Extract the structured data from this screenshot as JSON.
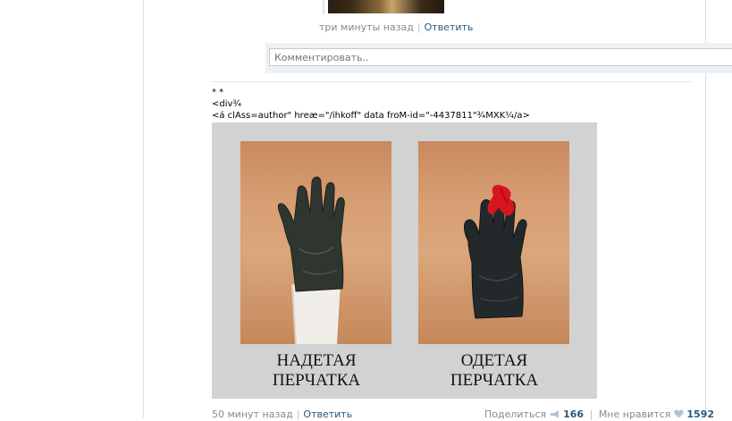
{
  "previous_post": {
    "time": "три минуты назад",
    "reply_label": "Ответить"
  },
  "comment": {
    "placeholder": "Комментировать.."
  },
  "post": {
    "code_line_1": "* *",
    "code_line_2": "<div¾",
    "code_line_3": "<á clAss=author\" hreæ=\"/ihkoff\" data froM-id=\"-4437811\"¾MXK¼/a>",
    "image": {
      "caption_left_1": "НАДЕТАЯ",
      "caption_left_2": "ПЕРЧАТКА",
      "caption_right_1": "ОДЕТАЯ",
      "caption_right_2": "ПЕРЧАТКА"
    },
    "time": "50 минут назад",
    "reply_label": "Ответить",
    "share_label": "Поделиться",
    "share_count": "166",
    "like_label": "Мне нравится",
    "like_count": "1592"
  },
  "icons": {
    "share": "megaphone-icon",
    "like": "heart-icon"
  },
  "colors": {
    "link": "#2b587a",
    "meta": "#8a8a8a",
    "border": "#c0cad5"
  }
}
